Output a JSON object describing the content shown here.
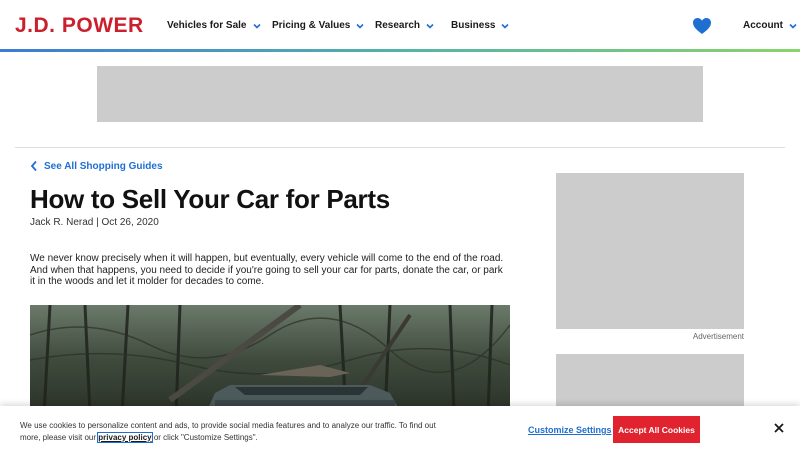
{
  "header": {
    "logo": "J.D. POWER",
    "nav": [
      {
        "label": "Vehicles for Sale"
      },
      {
        "label": "Pricing & Values"
      },
      {
        "label": "Research"
      },
      {
        "label": "Business"
      }
    ],
    "account_label": "Account",
    "favorites_icon": "heart-icon"
  },
  "breadcrumb": {
    "back_label": "See All Shopping Guides"
  },
  "article": {
    "title": "How to Sell Your Car for Parts",
    "byline": "Jack R. Nerad | Oct 26, 2020",
    "intro": "We never know precisely when it will happen, but eventually, every vehicle will come to the end of the road. And when that happens, you need to decide if you're going to sell your car for parts, donate the car, or park it in the woods and let it molder for decades to come."
  },
  "sidebar": {
    "ad_label": "Advertisement"
  },
  "cookie_banner": {
    "text_before": "We use cookies to personalize content and ads, to provide social media features and to analyze our traffic. To find out more, please visit our ",
    "link_label": "privacy policy",
    "text_after": " or click \"Customize Settings\".",
    "customize_label": "Customize Settings",
    "accept_label": "Accept All Cookies"
  },
  "colors": {
    "brand_red": "#cc1f2d",
    "link_blue": "#1f6fd1",
    "accept_red": "#e0232f",
    "ad_gray": "#cccccc"
  }
}
